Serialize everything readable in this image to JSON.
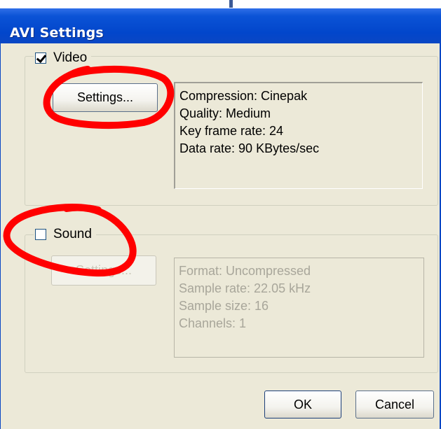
{
  "window": {
    "title": "AVI Settings"
  },
  "video": {
    "label": "Video",
    "checked": true,
    "settings_button": "Settings...",
    "info": [
      "Compression: Cinepak",
      "Quality: Medium",
      "Key frame rate: 24",
      "Data rate: 90 KBytes/sec"
    ]
  },
  "sound": {
    "label": "Sound",
    "checked": false,
    "settings_button": "Settings...",
    "info": [
      "Format: Uncompressed",
      "Sample rate: 22.05 kHz",
      "Sample size: 16",
      "Channels: 1"
    ]
  },
  "buttons": {
    "ok": "OK",
    "cancel": "Cancel"
  },
  "colors": {
    "titlebar": "#0a47c4",
    "dialog_background": "#ece9d8",
    "annotation": "#ff0000"
  }
}
